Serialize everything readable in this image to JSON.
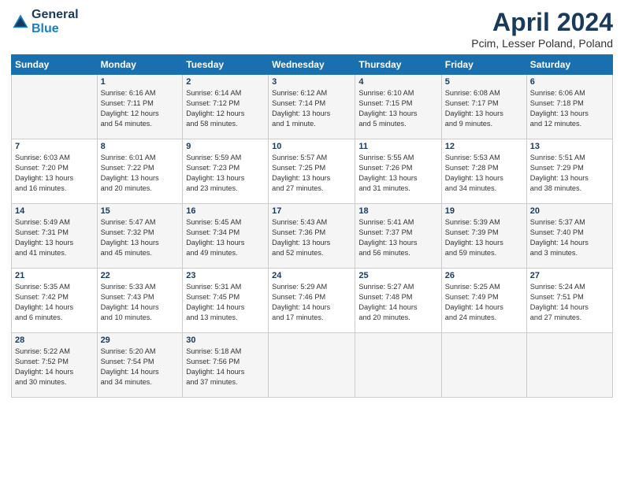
{
  "header": {
    "logo_line1": "General",
    "logo_line2": "Blue",
    "month": "April 2024",
    "location": "Pcim, Lesser Poland, Poland"
  },
  "days_of_week": [
    "Sunday",
    "Monday",
    "Tuesday",
    "Wednesday",
    "Thursday",
    "Friday",
    "Saturday"
  ],
  "weeks": [
    [
      {
        "num": "",
        "info": ""
      },
      {
        "num": "1",
        "info": "Sunrise: 6:16 AM\nSunset: 7:11 PM\nDaylight: 12 hours\nand 54 minutes."
      },
      {
        "num": "2",
        "info": "Sunrise: 6:14 AM\nSunset: 7:12 PM\nDaylight: 12 hours\nand 58 minutes."
      },
      {
        "num": "3",
        "info": "Sunrise: 6:12 AM\nSunset: 7:14 PM\nDaylight: 13 hours\nand 1 minute."
      },
      {
        "num": "4",
        "info": "Sunrise: 6:10 AM\nSunset: 7:15 PM\nDaylight: 13 hours\nand 5 minutes."
      },
      {
        "num": "5",
        "info": "Sunrise: 6:08 AM\nSunset: 7:17 PM\nDaylight: 13 hours\nand 9 minutes."
      },
      {
        "num": "6",
        "info": "Sunrise: 6:06 AM\nSunset: 7:18 PM\nDaylight: 13 hours\nand 12 minutes."
      }
    ],
    [
      {
        "num": "7",
        "info": "Sunrise: 6:03 AM\nSunset: 7:20 PM\nDaylight: 13 hours\nand 16 minutes."
      },
      {
        "num": "8",
        "info": "Sunrise: 6:01 AM\nSunset: 7:22 PM\nDaylight: 13 hours\nand 20 minutes."
      },
      {
        "num": "9",
        "info": "Sunrise: 5:59 AM\nSunset: 7:23 PM\nDaylight: 13 hours\nand 23 minutes."
      },
      {
        "num": "10",
        "info": "Sunrise: 5:57 AM\nSunset: 7:25 PM\nDaylight: 13 hours\nand 27 minutes."
      },
      {
        "num": "11",
        "info": "Sunrise: 5:55 AM\nSunset: 7:26 PM\nDaylight: 13 hours\nand 31 minutes."
      },
      {
        "num": "12",
        "info": "Sunrise: 5:53 AM\nSunset: 7:28 PM\nDaylight: 13 hours\nand 34 minutes."
      },
      {
        "num": "13",
        "info": "Sunrise: 5:51 AM\nSunset: 7:29 PM\nDaylight: 13 hours\nand 38 minutes."
      }
    ],
    [
      {
        "num": "14",
        "info": "Sunrise: 5:49 AM\nSunset: 7:31 PM\nDaylight: 13 hours\nand 41 minutes."
      },
      {
        "num": "15",
        "info": "Sunrise: 5:47 AM\nSunset: 7:32 PM\nDaylight: 13 hours\nand 45 minutes."
      },
      {
        "num": "16",
        "info": "Sunrise: 5:45 AM\nSunset: 7:34 PM\nDaylight: 13 hours\nand 49 minutes."
      },
      {
        "num": "17",
        "info": "Sunrise: 5:43 AM\nSunset: 7:36 PM\nDaylight: 13 hours\nand 52 minutes."
      },
      {
        "num": "18",
        "info": "Sunrise: 5:41 AM\nSunset: 7:37 PM\nDaylight: 13 hours\nand 56 minutes."
      },
      {
        "num": "19",
        "info": "Sunrise: 5:39 AM\nSunset: 7:39 PM\nDaylight: 13 hours\nand 59 minutes."
      },
      {
        "num": "20",
        "info": "Sunrise: 5:37 AM\nSunset: 7:40 PM\nDaylight: 14 hours\nand 3 minutes."
      }
    ],
    [
      {
        "num": "21",
        "info": "Sunrise: 5:35 AM\nSunset: 7:42 PM\nDaylight: 14 hours\nand 6 minutes."
      },
      {
        "num": "22",
        "info": "Sunrise: 5:33 AM\nSunset: 7:43 PM\nDaylight: 14 hours\nand 10 minutes."
      },
      {
        "num": "23",
        "info": "Sunrise: 5:31 AM\nSunset: 7:45 PM\nDaylight: 14 hours\nand 13 minutes."
      },
      {
        "num": "24",
        "info": "Sunrise: 5:29 AM\nSunset: 7:46 PM\nDaylight: 14 hours\nand 17 minutes."
      },
      {
        "num": "25",
        "info": "Sunrise: 5:27 AM\nSunset: 7:48 PM\nDaylight: 14 hours\nand 20 minutes."
      },
      {
        "num": "26",
        "info": "Sunrise: 5:25 AM\nSunset: 7:49 PM\nDaylight: 14 hours\nand 24 minutes."
      },
      {
        "num": "27",
        "info": "Sunrise: 5:24 AM\nSunset: 7:51 PM\nDaylight: 14 hours\nand 27 minutes."
      }
    ],
    [
      {
        "num": "28",
        "info": "Sunrise: 5:22 AM\nSunset: 7:52 PM\nDaylight: 14 hours\nand 30 minutes."
      },
      {
        "num": "29",
        "info": "Sunrise: 5:20 AM\nSunset: 7:54 PM\nDaylight: 14 hours\nand 34 minutes."
      },
      {
        "num": "30",
        "info": "Sunrise: 5:18 AM\nSunset: 7:56 PM\nDaylight: 14 hours\nand 37 minutes."
      },
      {
        "num": "",
        "info": ""
      },
      {
        "num": "",
        "info": ""
      },
      {
        "num": "",
        "info": ""
      },
      {
        "num": "",
        "info": ""
      }
    ]
  ]
}
